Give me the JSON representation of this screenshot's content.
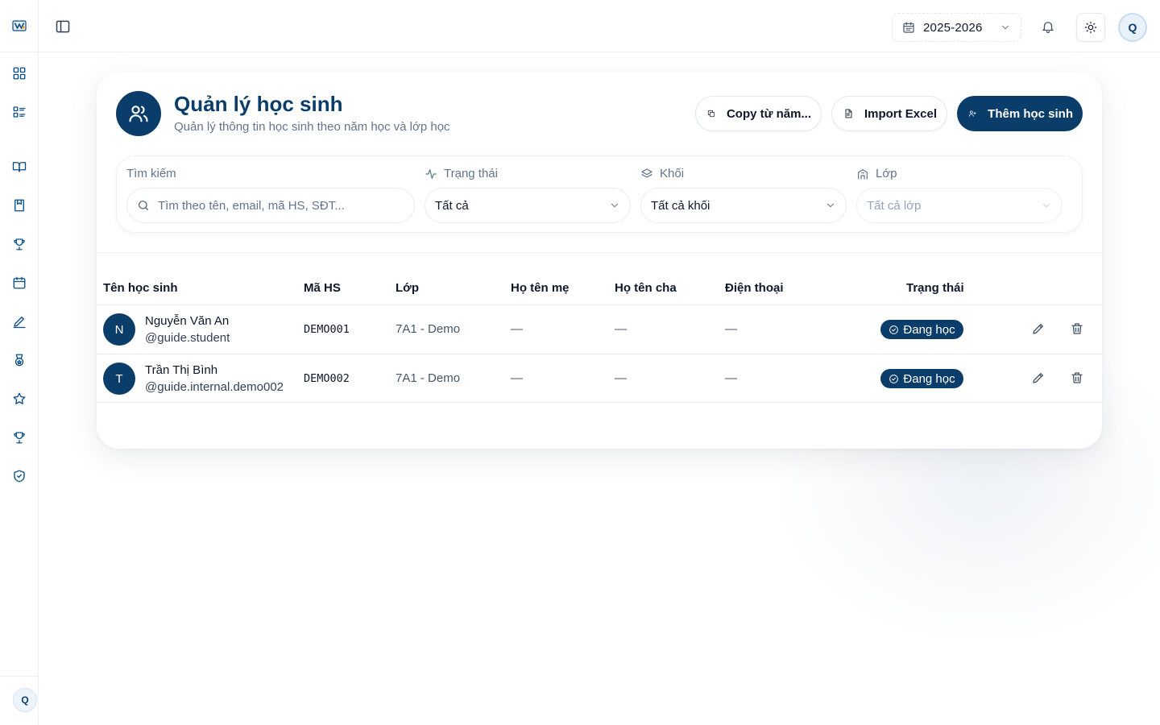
{
  "topbar": {
    "school_year": "2025-2026",
    "user_initial": "Q"
  },
  "sidebar": {
    "user_initial": "Q",
    "items": [
      {
        "icon": "dashboard-icon"
      },
      {
        "icon": "list-icon"
      },
      {
        "icon": "book-open-icon"
      },
      {
        "icon": "bookmark-icon"
      },
      {
        "icon": "trophy-icon"
      },
      {
        "icon": "calendar-icon"
      },
      {
        "icon": "pencil-icon"
      },
      {
        "icon": "medal-icon"
      },
      {
        "icon": "star-icon"
      },
      {
        "icon": "trophy-icon"
      },
      {
        "icon": "shield-check-icon"
      }
    ]
  },
  "header": {
    "title": "Quản lý học sinh",
    "subtitle": "Quản lý thông tin học sinh theo năm học và lớp học",
    "copy_label": "Copy từ năm...",
    "import_label": "Import Excel",
    "add_label": "Thêm học sinh"
  },
  "filters": {
    "search_label": "Tìm kiếm",
    "search_placeholder": "Tìm theo tên, email, mã HS, SĐT...",
    "status_label": "Trạng thái",
    "status_value": "Tất cả",
    "grade_label": "Khối",
    "grade_value": "Tất cả khối",
    "class_label": "Lớp",
    "class_value": "Tất cả lớp"
  },
  "table": {
    "columns": [
      "Tên học sinh",
      "Mã HS",
      "Lớp",
      "Họ tên mẹ",
      "Họ tên cha",
      "Điện thoại",
      "Trạng thái"
    ],
    "rows": [
      {
        "initial": "N",
        "name": "Nguyễn Văn An",
        "username": "@guide.student",
        "code": "DEMO001",
        "class": "7A1 - Demo",
        "mother": "—",
        "father": "—",
        "phone": "—",
        "status": "Đang học"
      },
      {
        "initial": "T",
        "name": "Trần Thị Bình",
        "username": "@guide.internal.demo002",
        "code": "DEMO002",
        "class": "7A1 - Demo",
        "mother": "—",
        "father": "—",
        "phone": "—",
        "status": "Đang học"
      }
    ]
  },
  "colors": {
    "primary": "#0b3d6b",
    "muted_text": "#64748b",
    "border": "#e2e8f0"
  }
}
